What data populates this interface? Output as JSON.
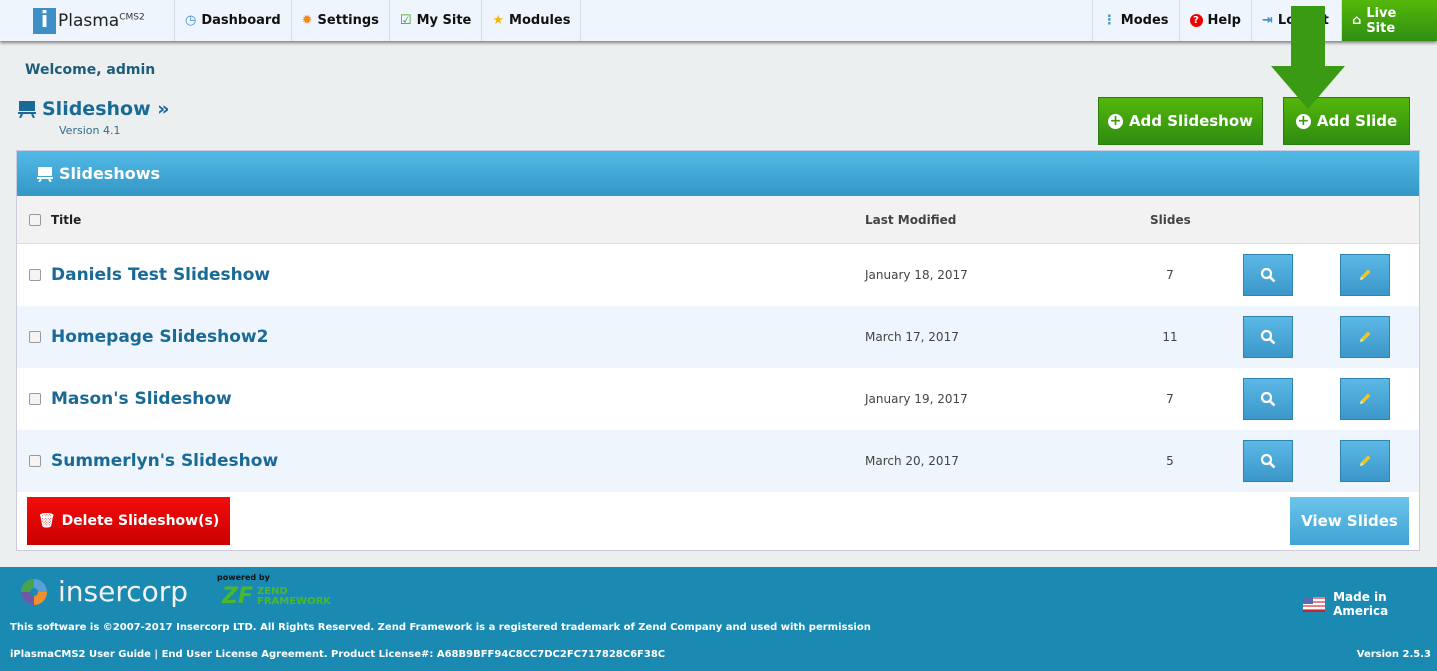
{
  "topbar": {
    "logo_i": "i",
    "logo_text": "Plasma",
    "logo_sup": "CMS2",
    "nav": [
      {
        "label": "Dashboard",
        "icon": "dashboard-icon"
      },
      {
        "label": "Settings",
        "icon": "gear-icon"
      },
      {
        "label": "My Site",
        "icon": "edit-icon"
      },
      {
        "label": "Modules",
        "icon": "star-icon"
      }
    ],
    "right": [
      {
        "label": "Modes",
        "icon": "dots-icon"
      },
      {
        "label": "Help",
        "icon": "help-icon"
      },
      {
        "label": "Logout",
        "icon": "logout-icon"
      }
    ],
    "live_site": "Live Site"
  },
  "welcome": "Welcome, admin",
  "page": {
    "title": "Slideshow »",
    "version": "Version 4.1"
  },
  "actions": {
    "add_slideshow": "Add Slideshow",
    "add_slide": "Add Slide"
  },
  "panel": {
    "title": "Slideshows",
    "columns": {
      "title": "Title",
      "modified": "Last Modified",
      "slides": "Slides"
    },
    "rows": [
      {
        "title": "Daniels Test Slideshow",
        "modified": "January 18, 2017",
        "slides": "7"
      },
      {
        "title": "Homepage Slideshow2",
        "modified": "March 17, 2017",
        "slides": "11"
      },
      {
        "title": "Mason's Slideshow",
        "modified": "January 19, 2017",
        "slides": "7"
      },
      {
        "title": "Summerlyn's Slideshow",
        "modified": "March 20, 2017",
        "slides": "5"
      }
    ],
    "delete": "Delete Slideshow(s)",
    "view_slides": "View Slides"
  },
  "footer": {
    "brand": "insercorp",
    "powered_by": "powered by",
    "zend1": "ZEND",
    "zend2": "FRAMEWORK",
    "made": "Made in America",
    "copyright": "This software is ©2007-2017 Insercorp LTD. All Rights Reserved. Zend Framework is a registered trademark of Zend Company and used with permission",
    "license": "iPlasmaCMS2 User Guide | End User License Agreement. Product License#: A68B9BFF94C8CC7DC2FC717828C6F38C",
    "version": "Version 2.5.3"
  },
  "colors": {
    "green": "#3a9a10",
    "blue": "#1a6a96",
    "footer": "#1a8ab2",
    "red": "#e00000"
  }
}
